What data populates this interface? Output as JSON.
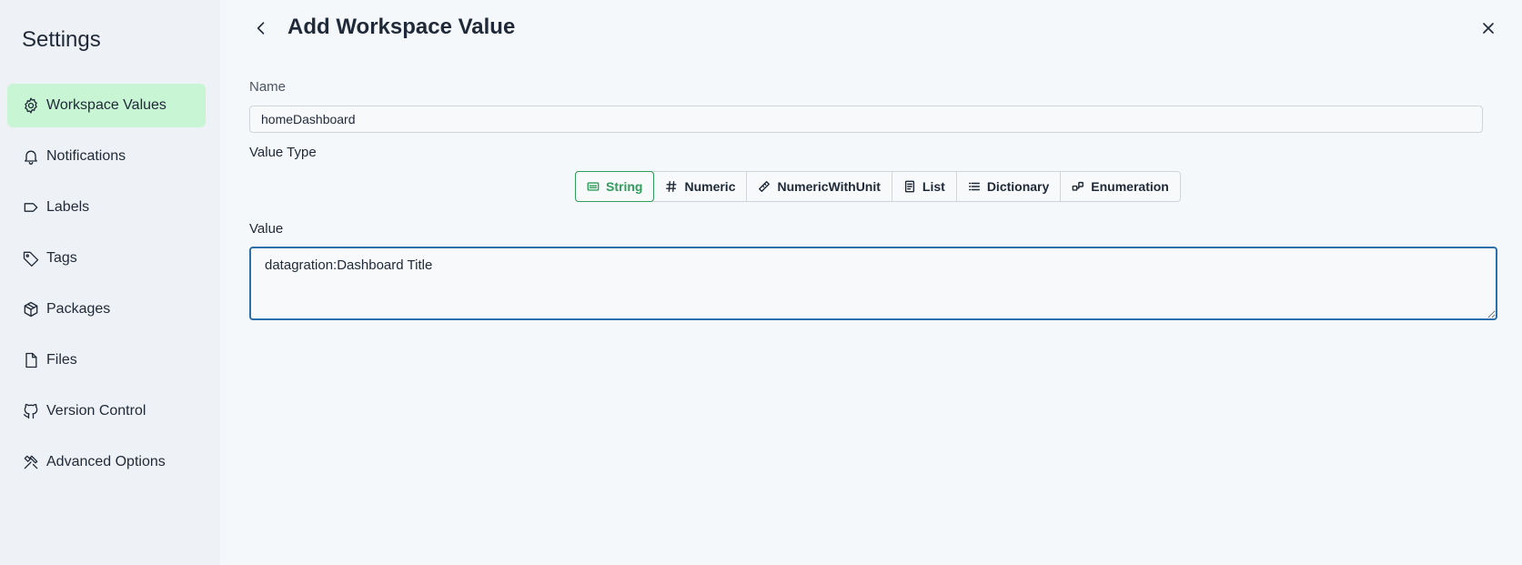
{
  "sidebar": {
    "title": "Settings",
    "items": [
      {
        "label": "Workspace Values",
        "icon": "gear-icon",
        "active": true
      },
      {
        "label": "Notifications",
        "icon": "bell-icon"
      },
      {
        "label": "Labels",
        "icon": "label-icon"
      },
      {
        "label": "Tags",
        "icon": "tag-icon"
      },
      {
        "label": "Packages",
        "icon": "package-icon"
      },
      {
        "label": "Files",
        "icon": "file-icon"
      },
      {
        "label": "Version Control",
        "icon": "github-icon"
      },
      {
        "label": "Advanced Options",
        "icon": "tools-icon"
      }
    ]
  },
  "header": {
    "title": "Add Workspace Value",
    "back_icon": "chevron-left-icon",
    "close_icon": "close-icon"
  },
  "form": {
    "name_label": "Name",
    "name_value": "homeDashboard",
    "type_label": "Value Type",
    "types": [
      {
        "label": "String",
        "icon": "string-icon",
        "selected": true
      },
      {
        "label": "Numeric",
        "icon": "hash-icon"
      },
      {
        "label": "NumericWithUnit",
        "icon": "ruler-icon"
      },
      {
        "label": "List",
        "icon": "list-doc-icon"
      },
      {
        "label": "Dictionary",
        "icon": "list-icon"
      },
      {
        "label": "Enumeration",
        "icon": "enumeration-icon"
      }
    ],
    "value_label": "Value",
    "value_text": "datagration:Dashboard Title"
  },
  "colors": {
    "accent": "#2f9e5a",
    "active_nav_bg": "#c8f5d4",
    "focus_border": "#2c6fab"
  }
}
